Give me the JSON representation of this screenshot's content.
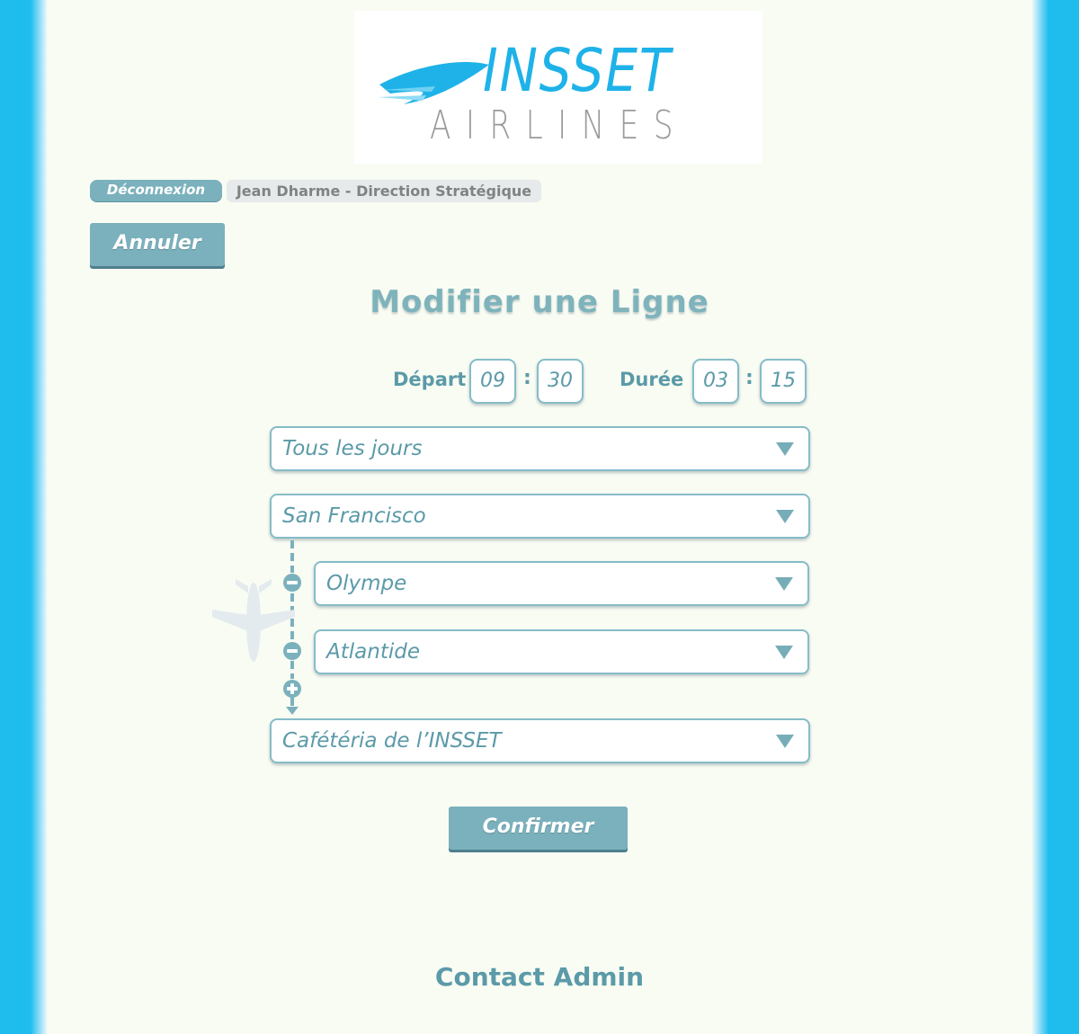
{
  "logo": {
    "main": "INSSET",
    "sub": "AIRLINES"
  },
  "user_bar": {
    "logout_label": "Déconnexion",
    "user_label": "Jean Dharme - Direction Stratégique"
  },
  "cancel_label": "Annuler",
  "title": "Modifier une Ligne",
  "departure": {
    "label": "Départ",
    "hours": "09",
    "minutes": "30"
  },
  "duration": {
    "label": "Durée",
    "hours": "03",
    "minutes": "15"
  },
  "separator": ":",
  "frequency": {
    "value": "Tous les jours"
  },
  "route": {
    "origin": "San Francisco",
    "stops": [
      "Olympe",
      "Atlantide"
    ],
    "destination": "Cafétéria de l’INSSET"
  },
  "confirm_label": "Confirmer",
  "footer": {
    "contact": "Contact Admin"
  },
  "colors": {
    "accent": "#7ab1bd",
    "text": "#5b9aa8",
    "side": "#1ebdee",
    "logo_blue": "#1eb2e8",
    "background": "#f9fcf3"
  },
  "icons": {
    "select_arrow": "triangle-down-icon",
    "remove_stop": "minus-circle-icon",
    "add_stop": "plus-circle-icon",
    "plane": "plane-icon"
  }
}
